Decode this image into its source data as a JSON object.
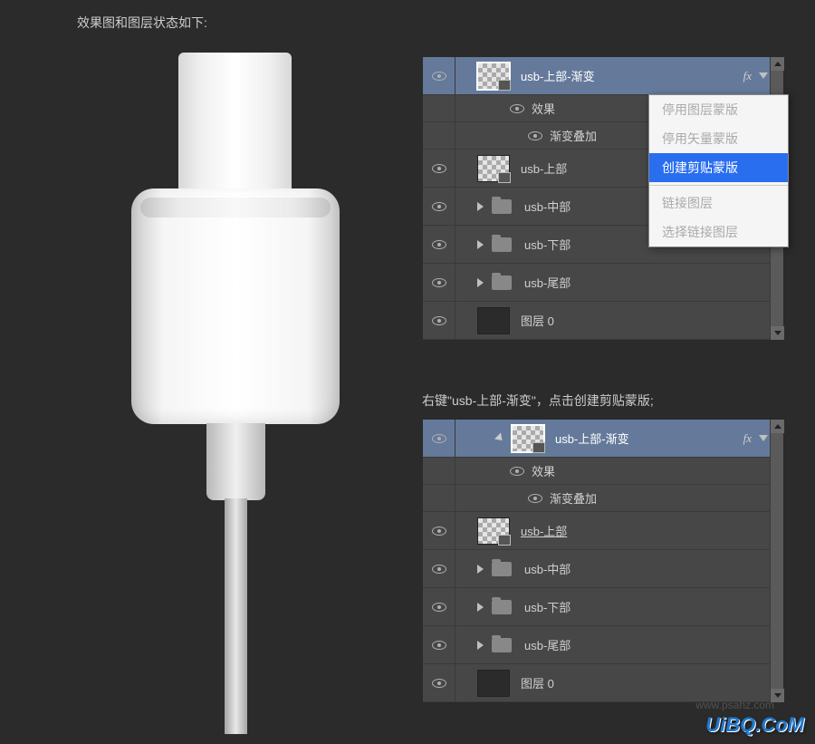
{
  "captions": {
    "top": "效果图和图层状态如下:",
    "middle": "右键\"usb-上部-渐变\"，点击创建剪贴蒙版;"
  },
  "panel1": {
    "layers": [
      {
        "name": "usb-上部-渐变",
        "fx": "fx",
        "selected": true
      },
      {
        "name": "效果"
      },
      {
        "name": "渐变叠加"
      },
      {
        "name": "usb-上部"
      },
      {
        "name": "usb-中部"
      },
      {
        "name": "usb-下部"
      },
      {
        "name": "usb-尾部"
      },
      {
        "name": "图层 0"
      }
    ]
  },
  "panel2": {
    "layers": [
      {
        "name": "usb-上部-渐变",
        "fx": "fx",
        "selected": true
      },
      {
        "name": "效果"
      },
      {
        "name": "渐变叠加"
      },
      {
        "name": "usb-上部"
      },
      {
        "name": "usb-中部"
      },
      {
        "name": "usb-下部"
      },
      {
        "name": "usb-尾部"
      },
      {
        "name": "图层 0"
      }
    ]
  },
  "context_menu": {
    "items": [
      {
        "label": "停用图层蒙版",
        "disabled": true
      },
      {
        "label": "停用矢量蒙版",
        "disabled": true
      },
      {
        "label": "创建剪贴蒙版",
        "selected": true
      },
      {
        "label": "链接图层",
        "disabled": true
      },
      {
        "label": "选择链接图层",
        "disabled": true
      }
    ]
  },
  "watermark": "UiBQ.CoM",
  "watermark2": "www.psahz.com"
}
